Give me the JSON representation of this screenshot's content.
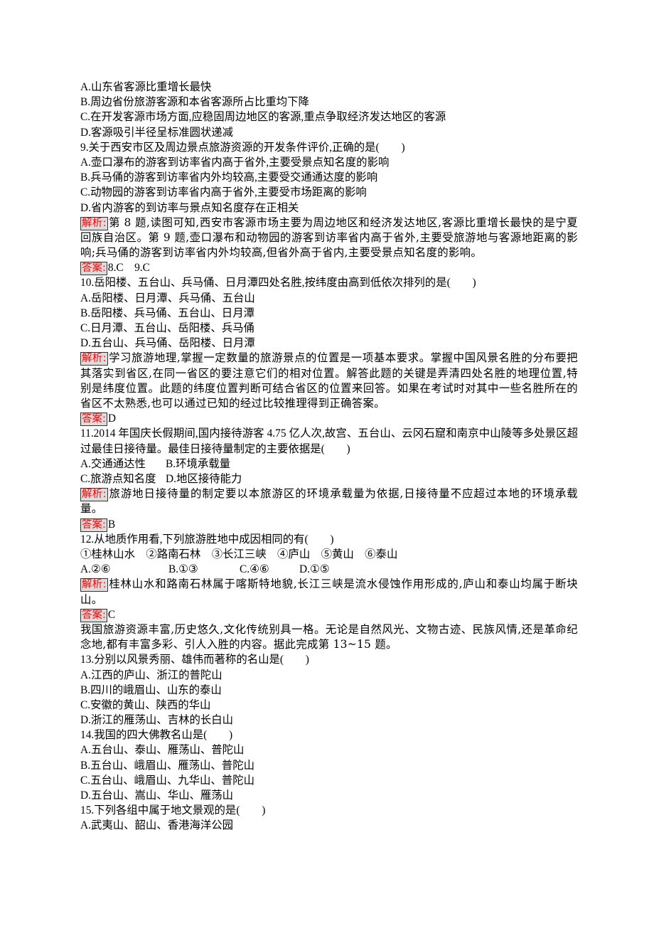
{
  "q8_options": [
    "A.山东省客源比重增长最快",
    "B.周边省份旅游客源和本省客源所占比重均下降",
    "C.在开发客源市场方面,应稳固周边地区的客源,重点争取经济发达地区的客源",
    "D.客源吸引半径呈标准圆状递减"
  ],
  "q9": {
    "stem": "9.关于西安市区及周边景点旅游资源的开发条件评价,正确的是(　　)",
    "options": [
      "A.壶口瀑布的游客到访率省内高于省外,主要受景点知名度的影响",
      "B.兵马俑的游客到访率省内外均较高,主要受交通通达度的影响",
      "C.动物园的游客到访率省内高于省外,主要受市场距离的影响",
      "D.省内游客的到访率与景点知名度存在正相关"
    ]
  },
  "labels": {
    "analysis": "解析:",
    "answer": "答案:"
  },
  "a89": {
    "analysis": "第 8 题,读图可知,西安市客源市场主要为周边地区和经济发达地区,客源比重增长最快的是宁夏回族自治区。第 9 题,壶口瀑布和动物园的游客到访率省内高于省外,主要受旅游地与客源地距离的影响;兵马俑的游客到访率省内外均较高,但省外高于省内,主要受景点知名度的影响。",
    "answer": "8.C　9.C"
  },
  "q10": {
    "stem": "10.岳阳楼、五台山、兵马俑、日月潭四处名胜,按纬度由高到低依次排列的是(　　)",
    "options": [
      "A.岳阳楼、日月潭、兵马俑、五台山",
      "B.岳阳楼、兵马俑、五台山、日月潭",
      "C.日月潭、五台山、岳阳楼、兵马俑",
      "D.五台山、兵马俑、岳阳楼、日月潭"
    ],
    "analysis": "学习旅游地理,掌握一定数量的旅游景点的位置是一项基本要求。掌握中国风景名胜的分布要把其落实到省区,在同一省区的要注意它们的相对位置。解答此题的关键是弄清四处名胜的地理位置,特别是纬度位置。此题的纬度位置判断可结合省区的位置来回答。如果在考试时对其中一些名胜所在的省区不太熟悉,也可以通过已知的经过比较推理得到正确答案。",
    "answer": "D"
  },
  "q11": {
    "stem": "11.2014 年国庆长假期间,国内接待游客 4.75 亿人次,故宫、五台山、云冈石窟和南京中山陵等多处景区超过最佳日接待量。最佳日接待量制定的主要依据是(　　)",
    "options": [
      "A.交通通达性",
      "B.环境承载量",
      "C.旅游点知名度",
      "D.地区接待能力"
    ],
    "analysis": "旅游地日接待量的制定要以本旅游区的环境承载量为依据,日接待量不应超过本地的环境承载量。",
    "answer": "B"
  },
  "q12": {
    "stem": "12.从地质作用看,下列旅游胜地中成因相同的有(　　)",
    "items": "①桂林山水　②路南石林　③长江三峡　④庐山　⑤黄山　⑥泰山",
    "options": [
      "A.②⑥",
      "B.①③",
      "C.④⑥",
      "D.①⑤"
    ],
    "analysis": "桂林山水和路南石林属于喀斯特地貌,长江三峡是流水侵蚀作用形成的,庐山和泰山均属于断块山。",
    "answer": "C"
  },
  "intro_13_15": "我国旅游资源丰富,历史悠久,文化传统别具一格。无论是自然风光、文物古迹、民族风情,还是革命纪念地,都有丰富多彩、引人入胜的内容。据此完成第 13~15 题。",
  "q13": {
    "stem": "13.分别以风景秀丽、雄伟而著称的名山是(　　)",
    "options": [
      "A.江西的庐山、浙江的普陀山",
      "B.四川的峨眉山、山东的泰山",
      "C.安徽的黄山、陕西的华山",
      "D.浙江的雁荡山、吉林的长白山"
    ]
  },
  "q14": {
    "stem": "14.我国的四大佛教名山是(　　)",
    "options": [
      "A.五台山、泰山、雁荡山、普陀山",
      "B.五台山、峨眉山、雁荡山、普陀山",
      "C.五台山、峨眉山、九华山、普陀山",
      "D.五台山、嵩山、华山、雁荡山"
    ]
  },
  "q15": {
    "stem": "15.下列各组中属于地文景观的是(　　)",
    "options": [
      "A.武夷山、韶山、香港海洋公园"
    ]
  }
}
